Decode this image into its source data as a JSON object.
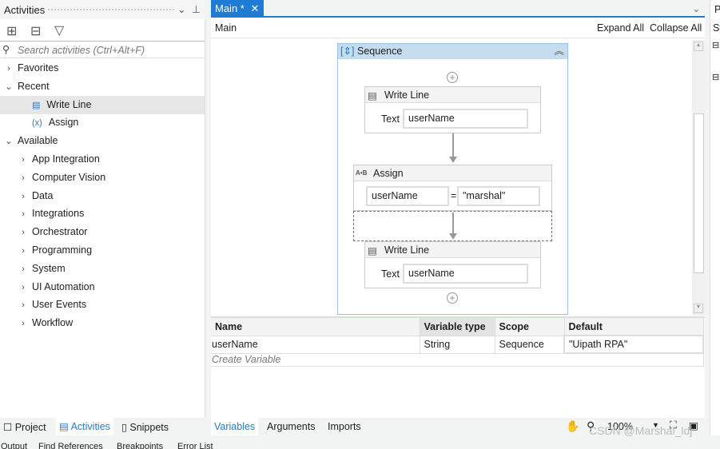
{
  "activities_panel": {
    "title": "Activities",
    "search_placeholder": "Search activities (Ctrl+Alt+F)",
    "tree": [
      {
        "label": "Favorites",
        "expanded": false,
        "level": 0
      },
      {
        "label": "Recent",
        "expanded": true,
        "level": 0
      },
      {
        "label": "Write Line",
        "level": 1,
        "icon": "write-line-icon",
        "selected": true
      },
      {
        "label": "Assign",
        "level": 1,
        "icon": "assign-icon"
      },
      {
        "label": "Available",
        "expanded": true,
        "level": 0
      },
      {
        "label": "App Integration",
        "level": 1
      },
      {
        "label": "Computer Vision",
        "level": 1
      },
      {
        "label": "Data",
        "level": 1
      },
      {
        "label": "Integrations",
        "level": 1
      },
      {
        "label": "Orchestrator",
        "level": 1
      },
      {
        "label": "Programming",
        "level": 1
      },
      {
        "label": "System",
        "level": 1
      },
      {
        "label": "UI Automation",
        "level": 1
      },
      {
        "label": "User Events",
        "level": 1
      },
      {
        "label": "Workflow",
        "level": 1
      }
    ],
    "bottom_tabs": [
      "Project",
      "Activities",
      "Snippets"
    ]
  },
  "designer": {
    "tab_label": "Main *",
    "breadcrumb": "Main",
    "expand_all": "Expand All",
    "collapse_all": "Collapse All",
    "sequence_title": "Sequence",
    "write_line_1": {
      "title": "Write Line",
      "text_label": "Text",
      "text_value": "userName"
    },
    "assign": {
      "title": "Assign",
      "to": "userName",
      "eq": "=",
      "value": "\"marshal\""
    },
    "write_line_2": {
      "title": "Write Line",
      "text_label": "Text",
      "text_value": "userName"
    }
  },
  "variables": {
    "columns": [
      "Name",
      "Variable type",
      "Scope",
      "Default"
    ],
    "rows": [
      [
        "userName",
        "String",
        "Sequence",
        "\"Uipath RPA\""
      ]
    ],
    "create_placeholder": "Create Variable"
  },
  "bottom_bar": {
    "tabs": [
      "Variables",
      "Arguments",
      "Imports"
    ],
    "zoom": "100%"
  },
  "output_tabs": [
    "Output",
    "Find References",
    "Breakpoints",
    "Error List"
  ],
  "right_panel": {
    "title": "P",
    "item": "Sy"
  },
  "watermark": "CSDN @Marshal_ldj",
  "colors": {
    "accent": "#1e7bd6",
    "sequence_header": "#c5dcef"
  }
}
